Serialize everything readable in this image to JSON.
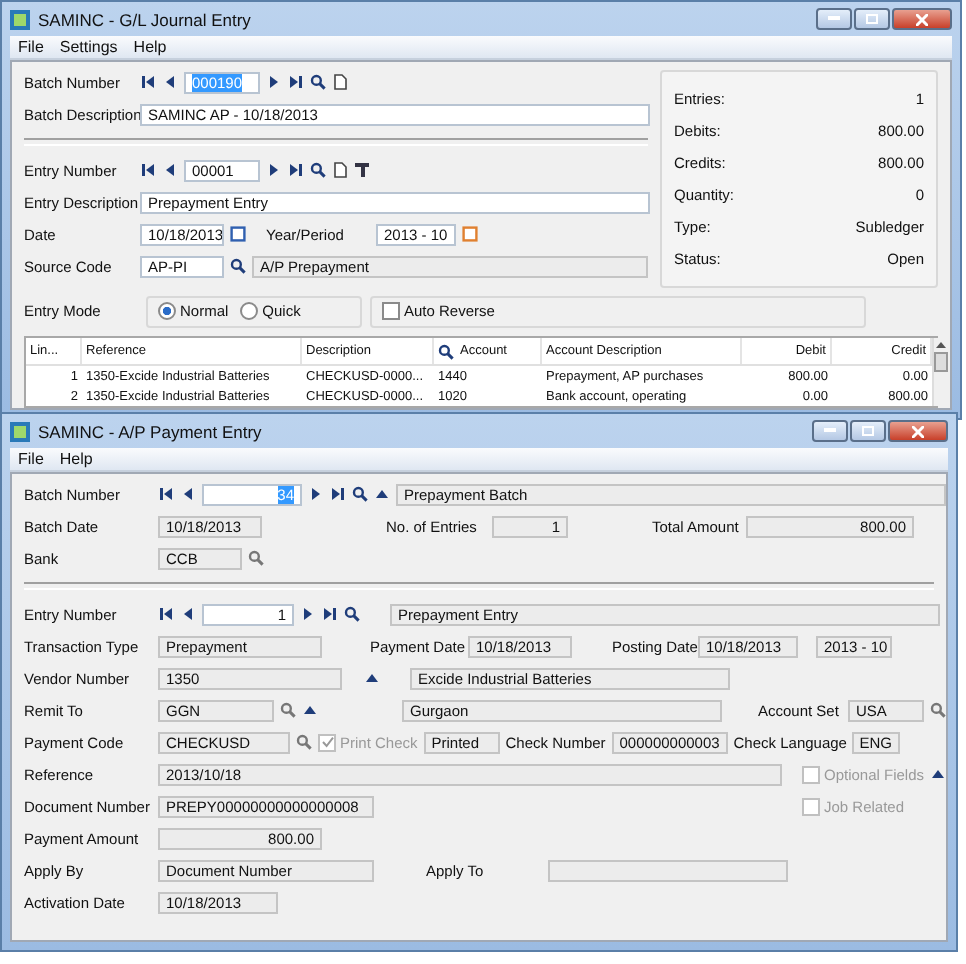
{
  "gl_window": {
    "title": "SAMINC - G/L Journal Entry",
    "menu": [
      "File",
      "Settings",
      "Help"
    ],
    "batch_number": {
      "label": "Batch Number",
      "value": "000190",
      "selected": true
    },
    "batch_description": {
      "label": "Batch Description",
      "value": "SAMINC AP - 10/18/2013"
    },
    "entry_number": {
      "label": "Entry Number",
      "value": "00001"
    },
    "entry_description": {
      "label": "Entry Description",
      "value": "Prepayment Entry"
    },
    "date": {
      "label": "Date",
      "value": "10/18/2013"
    },
    "year_period": {
      "label": "Year/Period",
      "value": "2013 - 10"
    },
    "source_code": {
      "label": "Source Code",
      "value": "AP-PI",
      "description": "A/P Prepayment"
    },
    "summary": [
      {
        "label": "Entries:",
        "value": "1"
      },
      {
        "label": "Debits:",
        "value": "800.00"
      },
      {
        "label": "Credits:",
        "value": "800.00"
      },
      {
        "label": "Quantity:",
        "value": "0"
      },
      {
        "label": "Type:",
        "value": "Subledger"
      },
      {
        "label": "Status:",
        "value": "Open"
      }
    ],
    "entry_mode": {
      "label": "Entry Mode",
      "options": [
        {
          "label": "Normal",
          "selected": true
        },
        {
          "label": "Quick",
          "selected": false
        }
      ]
    },
    "auto_reverse": {
      "label": "Auto Reverse",
      "checked": false
    },
    "table": {
      "columns": [
        "Lin...",
        "Reference",
        "Description",
        "Account",
        "Account Description",
        "Debit",
        "Credit"
      ],
      "rows": [
        [
          "1",
          "1350-Excide Industrial Batteries",
          "CHECKUSD-0000...",
          "1440",
          "Prepayment, AP purchases",
          "800.00",
          "0.00"
        ],
        [
          "2",
          "1350-Excide Industrial Batteries",
          "CHECKUSD-0000...",
          "1020",
          "Bank account, operating",
          "0.00",
          "800.00"
        ]
      ]
    }
  },
  "ap_window": {
    "title": "SAMINC - A/P Payment Entry",
    "menu": [
      "File",
      "Help"
    ],
    "batch_number": {
      "label": "Batch Number",
      "value": "34",
      "selected": true,
      "description": "Prepayment Batch"
    },
    "batch_date": {
      "label": "Batch Date",
      "value": "10/18/2013"
    },
    "no_of_entries": {
      "label": "No. of Entries",
      "value": "1"
    },
    "total_amount": {
      "label": "Total Amount",
      "value": "800.00"
    },
    "bank": {
      "label": "Bank",
      "value": "CCB"
    },
    "entry_number": {
      "label": "Entry Number",
      "value": "1",
      "description": "Prepayment Entry"
    },
    "transaction_type": {
      "label": "Transaction Type",
      "value": "Prepayment"
    },
    "payment_date": {
      "label": "Payment Date",
      "value": "10/18/2013"
    },
    "posting_date": {
      "label": "Posting Date",
      "value": "10/18/2013",
      "period": "2013 - 10"
    },
    "vendor_number": {
      "label": "Vendor Number",
      "value": "1350",
      "description": "Excide Industrial Batteries"
    },
    "remit_to": {
      "label": "Remit To",
      "value": "GGN",
      "description": "Gurgaon"
    },
    "account_set": {
      "label": "Account Set",
      "value": "USA"
    },
    "payment_code": {
      "label": "Payment Code",
      "value": "CHECKUSD"
    },
    "print_check": {
      "label": "Print Check",
      "checked": true,
      "disabled": true
    },
    "print_status": {
      "value": "Printed"
    },
    "check_number": {
      "label": "Check Number",
      "value": "000000000003"
    },
    "check_language": {
      "label": "Check Language",
      "value": "ENG"
    },
    "reference": {
      "label": "Reference",
      "value": "2013/10/18"
    },
    "optional_fields": {
      "label": "Optional Fields",
      "checked": false
    },
    "document_number": {
      "label": "Document Number",
      "value": "PREPY00000000000000008"
    },
    "job_related": {
      "label": "Job Related",
      "checked": false
    },
    "payment_amount": {
      "label": "Payment Amount",
      "value": "800.00"
    },
    "apply_by": {
      "label": "Apply By",
      "value": "Document Number"
    },
    "apply_to": {
      "label": "Apply To"
    },
    "activation_date": {
      "label": "Activation Date",
      "value": "10/18/2013"
    }
  }
}
